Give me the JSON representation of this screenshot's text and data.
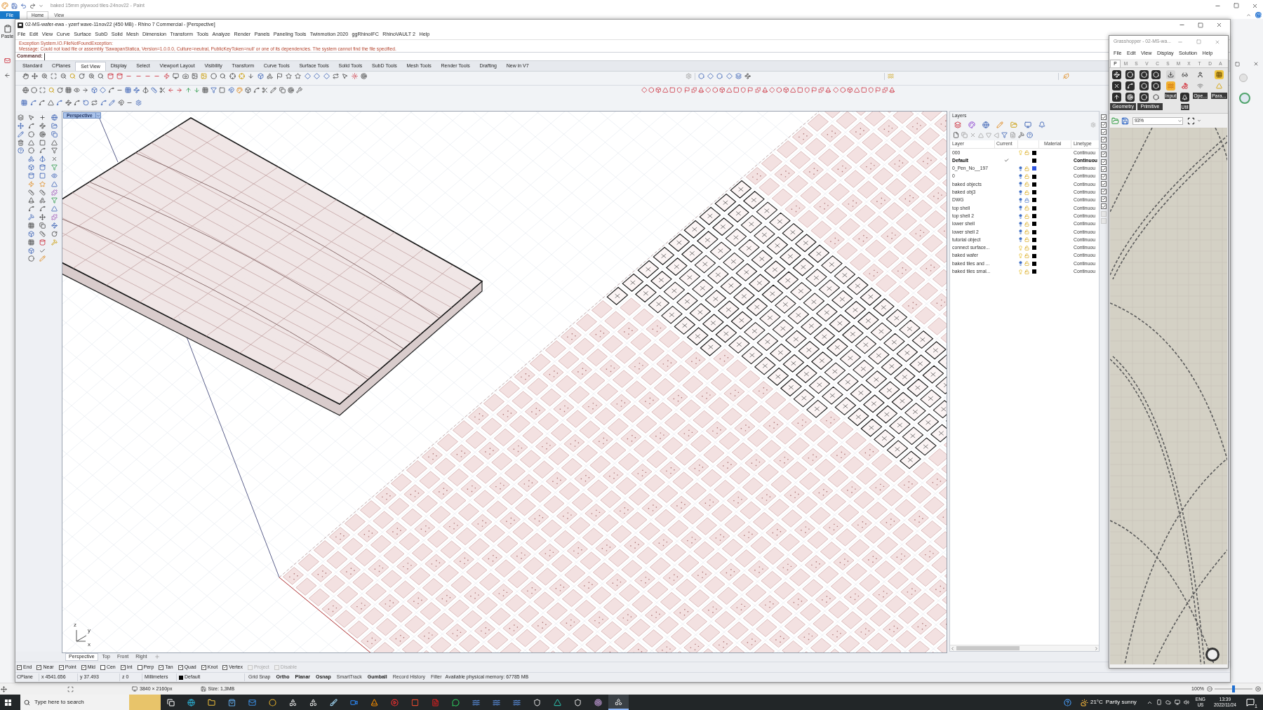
{
  "paint": {
    "title": "baked 15mm plywood tiles-24nov22 - Paint",
    "file_button": "File",
    "tabs": [
      {
        "label": "Home",
        "selected": true
      },
      {
        "label": "View",
        "selected": false
      }
    ],
    "ribbon_label": "Paste",
    "status": {
      "dimensions": "3840 × 2160px",
      "size": "Size: 1,3MB",
      "zoom": "100%",
      "zoom_slider": {
        "level": 0.5
      }
    }
  },
  "rhino": {
    "title": "02-MS-wafer-ewa - yzerf wave-11nov22 (450 MB) - Rhino 7 Commercial - [Perspective]",
    "menu": [
      "File",
      "Edit",
      "View",
      "Curve",
      "Surface",
      "SubD",
      "Solid",
      "Mesh",
      "Dimension",
      "Transform",
      "Tools",
      "Analyze",
      "Render",
      "Panels",
      "Paneling Tools",
      "Twinmotion 2020",
      "ggRhinoIFC",
      "RhinoVAULT 2",
      "Help"
    ],
    "command_history": [
      "Exception System.IO.FileNotFoundException:",
      "Message: Could not load file or assembly 'SawapanStatica, Version=1.0.0.0, Culture=neutral, PublicKeyToken=null' or one of its dependencies. The system cannot find the file specified."
    ],
    "command_label": "Command:",
    "toolbar_tabs": [
      {
        "label": "Standard",
        "selected": false
      },
      {
        "label": "CPlanes",
        "selected": false
      },
      {
        "label": "Set View",
        "selected": true
      },
      {
        "label": "Display",
        "selected": false
      },
      {
        "label": "Select",
        "selected": false
      },
      {
        "label": "Viewport Layout",
        "selected": false
      },
      {
        "label": "Visibility",
        "selected": false
      },
      {
        "label": "Transform",
        "selected": false
      },
      {
        "label": "Curve Tools",
        "selected": false
      },
      {
        "label": "Surface Tools",
        "selected": false
      },
      {
        "label": "Solid Tools",
        "selected": false
      },
      {
        "label": "SubD Tools",
        "selected": false
      },
      {
        "label": "Mesh Tools",
        "selected": false
      },
      {
        "label": "Render Tools",
        "selected": false
      },
      {
        "label": "Drafting",
        "selected": false
      },
      {
        "label": "New in V7",
        "selected": false
      }
    ],
    "viewport": {
      "title": "Perspective",
      "axis_labels": [
        "z",
        "y",
        "x"
      ]
    },
    "viewport_tabs": [
      {
        "label": "Perspective",
        "selected": true
      },
      {
        "label": "Top",
        "selected": false
      },
      {
        "label": "Front",
        "selected": false
      },
      {
        "label": "Right",
        "selected": false
      }
    ],
    "osnaps": [
      {
        "label": "End",
        "checked": true,
        "disabled": false
      },
      {
        "label": "Near",
        "checked": true,
        "disabled": false
      },
      {
        "label": "Point",
        "checked": true,
        "disabled": false
      },
      {
        "label": "Mid",
        "checked": true,
        "disabled": false
      },
      {
        "label": "Cen",
        "checked": false,
        "disabled": false
      },
      {
        "label": "Int",
        "checked": true,
        "disabled": false
      },
      {
        "label": "Perp",
        "checked": false,
        "disabled": false
      },
      {
        "label": "Tan",
        "checked": true,
        "disabled": false
      },
      {
        "label": "Quad",
        "checked": true,
        "disabled": false
      },
      {
        "label": "Knot",
        "checked": true,
        "disabled": false
      },
      {
        "label": "Vertex",
        "checked": true,
        "disabled": false
      },
      {
        "label": "Project",
        "checked": false,
        "disabled": true
      },
      {
        "label": "Disable",
        "checked": false,
        "disabled": true
      }
    ],
    "status_bar": {
      "cplane": "CPlane",
      "x": "x 4541.656",
      "y": "y 37.493",
      "z": "z 0",
      "units": "Millimeters",
      "layer": "Default",
      "toggles": [
        {
          "label": "Grid Snap",
          "on": false
        },
        {
          "label": "Ortho",
          "on": true
        },
        {
          "label": "Planar",
          "on": true
        },
        {
          "label": "Osnap",
          "on": true
        },
        {
          "label": "SmartTrack",
          "on": false
        },
        {
          "label": "Gumball",
          "on": true
        },
        {
          "label": "Record History",
          "on": false
        },
        {
          "label": "Filter",
          "on": false
        }
      ],
      "memory": "Available physical memory: 67785 MB"
    },
    "layers": {
      "title": "Layers",
      "columns": [
        "Layer",
        "Current",
        "Material",
        "Linetype"
      ],
      "rows": [
        {
          "name": "000",
          "current": false,
          "on": true,
          "locked": false,
          "color": "#000000",
          "linetype": "Continuou"
        },
        {
          "name": "Default",
          "current": true,
          "color": "#000000",
          "linetype": "Continuou"
        },
        {
          "name": "0_Pen_No__197",
          "current": false,
          "on": false,
          "locked": false,
          "color": "#2f55e0",
          "linetype": "Continuou"
        },
        {
          "name": "0",
          "current": false,
          "on": false,
          "locked": false,
          "color": "#000000",
          "linetype": "Continuou"
        },
        {
          "name": "baked objects",
          "current": false,
          "on": false,
          "locked": false,
          "color": "#000000",
          "linetype": "Continuou"
        },
        {
          "name": "baked obj3",
          "current": false,
          "on": false,
          "locked": false,
          "color": "#000000",
          "linetype": "Continuou"
        },
        {
          "name": "DWG",
          "current": false,
          "on": false,
          "locked": true,
          "color": "#000000",
          "linetype": "Continuou"
        },
        {
          "name": "top shell",
          "current": false,
          "on": false,
          "locked": false,
          "color": "#000000",
          "linetype": "Continuou"
        },
        {
          "name": "top shell 2",
          "current": false,
          "on": false,
          "locked": false,
          "color": "#000000",
          "linetype": "Continuou"
        },
        {
          "name": "lower shell",
          "current": false,
          "on": false,
          "locked": false,
          "color": "#000000",
          "linetype": "Continuou"
        },
        {
          "name": "lower shell 2",
          "current": false,
          "on": false,
          "locked": false,
          "color": "#000000",
          "linetype": "Continuou"
        },
        {
          "name": "tutorial object",
          "current": false,
          "on": false,
          "locked": false,
          "color": "#000000",
          "linetype": "Continuou"
        },
        {
          "name": "connect surface...",
          "current": false,
          "on": true,
          "locked": false,
          "color": "#000000",
          "linetype": "Continuou"
        },
        {
          "name": "baked wafer",
          "current": false,
          "on": true,
          "locked": false,
          "color": "#000000",
          "linetype": "Continuou"
        },
        {
          "name": "baked tiles and ...",
          "current": false,
          "on": false,
          "locked": false,
          "color": "#000000",
          "linetype": "Continuou"
        },
        {
          "name": "baked tiles smal...",
          "current": false,
          "on": true,
          "locked": false,
          "color": "#000000",
          "linetype": "Continuou"
        }
      ]
    },
    "panel_checkboxes": [
      {
        "checked": true
      },
      {
        "checked": true
      },
      {
        "checked": true
      },
      {
        "checked": true
      },
      {
        "checked": true
      },
      {
        "checked": true
      },
      {
        "checked": true
      },
      {
        "checked": true
      },
      {
        "checked": true
      },
      {
        "checked": true
      },
      {
        "checked": true
      },
      {
        "checked": true
      },
      {
        "checked": true
      },
      {
        "checked": false
      },
      {
        "checked": false
      }
    ]
  },
  "grasshopper": {
    "title": "Grasshopper - 02-MS-wa...",
    "menu": [
      "File",
      "Edit",
      "View",
      "Display",
      "Solution",
      "Help"
    ],
    "tabs": [
      {
        "label": "P",
        "selected": true
      },
      {
        "label": "M",
        "selected": false
      },
      {
        "label": "S",
        "selected": false
      },
      {
        "label": "V",
        "selected": false
      },
      {
        "label": "C",
        "selected": false
      },
      {
        "label": "S",
        "selected": false
      },
      {
        "label": "M",
        "selected": false
      },
      {
        "label": "X",
        "selected": false
      },
      {
        "label": "T",
        "selected": false
      },
      {
        "label": "D",
        "selected": false
      },
      {
        "label": "A",
        "selected": false
      }
    ],
    "groups": [
      "Geometry",
      "Primitive"
    ],
    "captions": [
      "Input",
      "Util",
      "Ope...",
      "Para..."
    ],
    "zoom": "93%"
  },
  "taskbar": {
    "search_placeholder": "Type here to search",
    "temperature": "21°C",
    "weather": "Partly sunny",
    "language": "ENG",
    "region": "US",
    "time": "13:39",
    "date": "2022/11/24",
    "notifications": "1"
  }
}
